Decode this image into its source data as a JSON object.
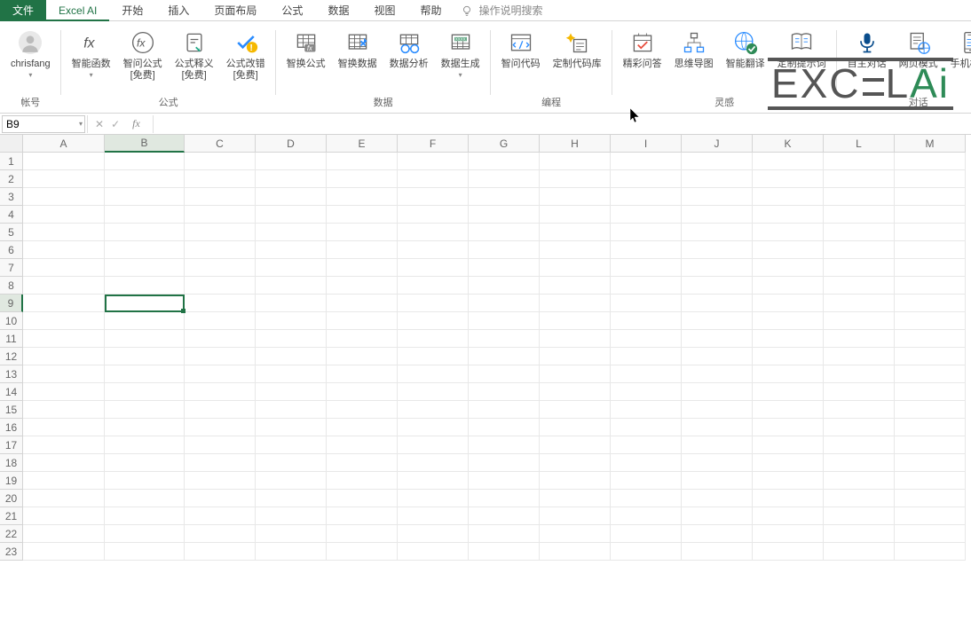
{
  "tabs": {
    "file": "文件",
    "active": "Excel AI",
    "others": [
      "开始",
      "插入",
      "页面布局",
      "公式",
      "数据",
      "视图",
      "帮助"
    ],
    "tell_me": "操作说明搜索"
  },
  "ribbon": {
    "account": {
      "name": "chrisfang",
      "group": "帐号"
    },
    "formula_group": {
      "label": "公式",
      "btn_fn": "智能函数",
      "btn_ask": "智问公式",
      "btn_ask2": "[免费]",
      "btn_explain": "公式释义",
      "btn_explain2": "[免费]",
      "btn_fix": "公式改错",
      "btn_fix2": "[免费]"
    },
    "data_group": {
      "label": "数据",
      "btn_swap_formula": "智换公式",
      "btn_swap_data": "智换数据",
      "btn_analyze": "数据分析",
      "btn_generate": "数据生成"
    },
    "code_group": {
      "label": "编程",
      "btn_ask_code": "智问代码",
      "btn_custom_lib": "定制代码库"
    },
    "insp_group": {
      "label": "灵感",
      "btn_qa": "精彩问答",
      "btn_mindmap": "思维导图",
      "btn_translate": "智能翻译",
      "btn_prompt": "定制提示词"
    },
    "chat_group": {
      "label": "对话",
      "btn_free_chat": "自主对话",
      "btn_web": "网页模式",
      "btn_mobile": "手机模式"
    }
  },
  "formula_bar": {
    "name_box": "B9"
  },
  "columns": [
    "A",
    "B",
    "C",
    "D",
    "E",
    "F",
    "G",
    "H",
    "I",
    "J",
    "K",
    "L",
    "M"
  ],
  "rows": [
    1,
    2,
    3,
    4,
    5,
    6,
    7,
    8,
    9,
    10,
    11,
    12,
    13,
    14,
    15,
    16,
    17,
    18,
    19,
    20,
    21,
    22,
    23
  ],
  "selected": {
    "col": "B",
    "row": 9
  },
  "watermark": {
    "t1": "EXC",
    "t2": "E",
    "t3": "L",
    "t4": "Ai"
  }
}
